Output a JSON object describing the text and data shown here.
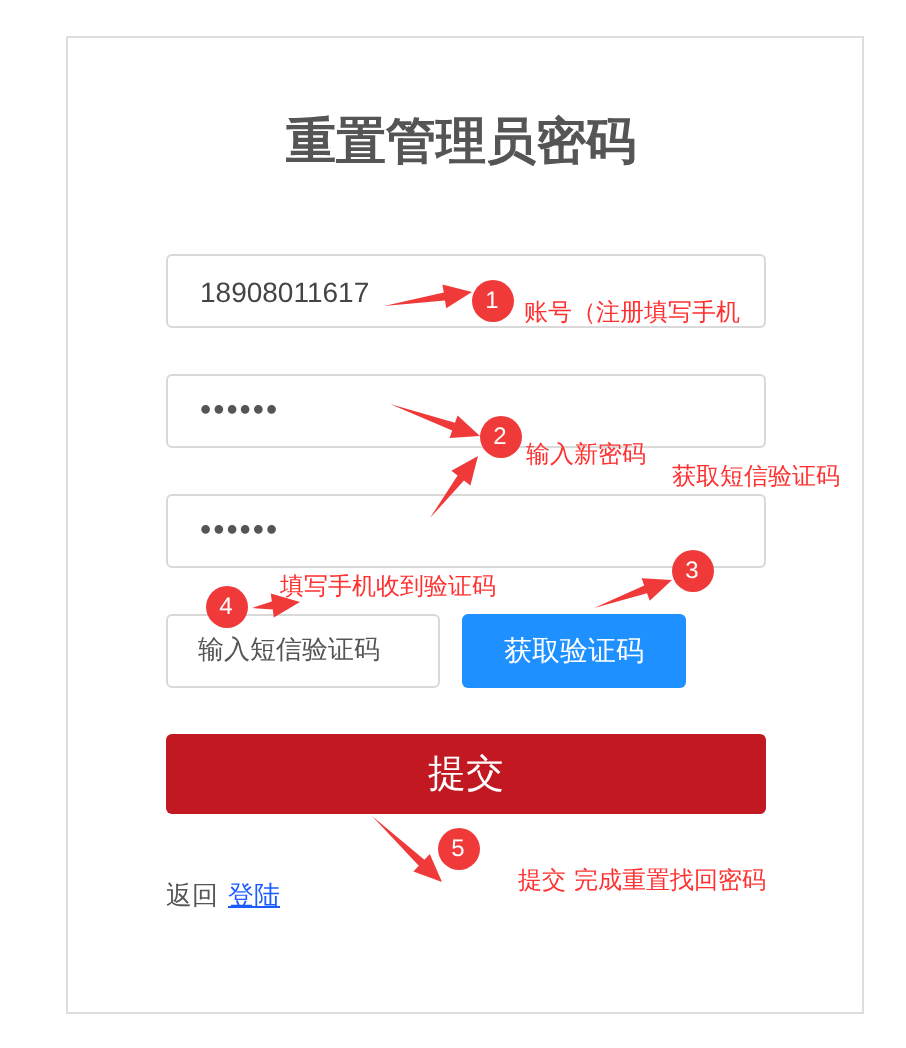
{
  "title": "重置管理员密码",
  "fields": [
    {
      "kind": "text",
      "value": "18908011617"
    },
    {
      "kind": "password",
      "value": "••••••"
    },
    {
      "kind": "password",
      "value": "••••••"
    }
  ],
  "code_field": {
    "placeholder": "输入短信验证码"
  },
  "code_button": "获取验证码",
  "submit_button": "提交",
  "footer": {
    "text": "返回",
    "link": "登陆"
  },
  "annotations": [
    {
      "number": "1",
      "text": "账号（注册填写手机"
    },
    {
      "number": "2",
      "text": "输入新密码"
    },
    {
      "number": "3",
      "text": "获取短信验证码"
    },
    {
      "number": "4",
      "text": "填写手机收到验证码"
    },
    {
      "number": "5",
      "text": "提交 完成重置找回密码"
    }
  ]
}
